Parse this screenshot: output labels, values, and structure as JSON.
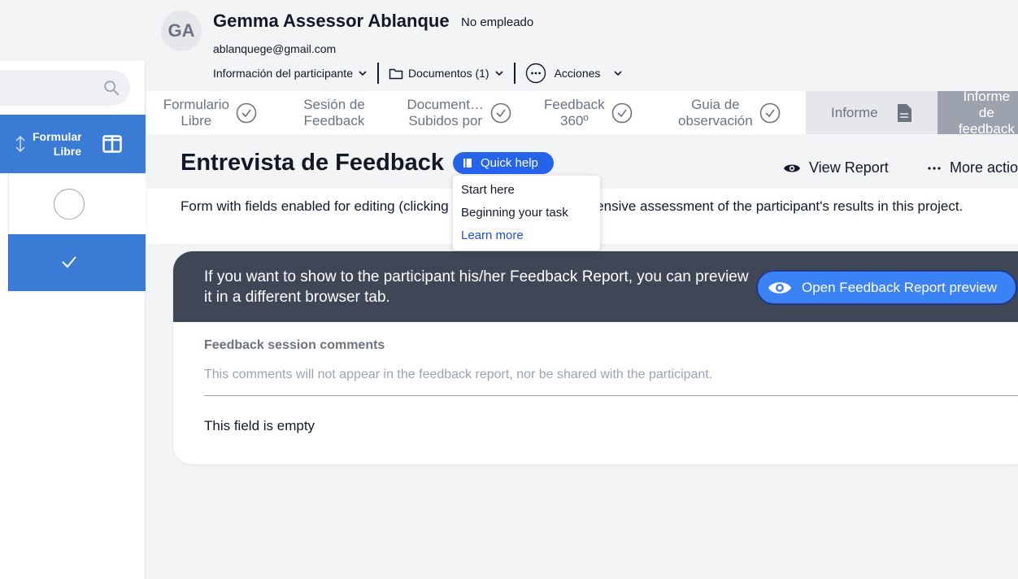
{
  "left_panel": {
    "search": {
      "icon": "search-icon"
    },
    "column_header": {
      "label": "Formulario\nLibre",
      "sort_icon": "sort-icon",
      "layout_icon": "columns-icon"
    }
  },
  "header": {
    "avatar_initials": "GA",
    "name": "Gemma Assessor Ablanque",
    "status": "No empleado",
    "email": "ablanquege@gmail.com",
    "menu": {
      "info_label": "Información del participante",
      "documents_label": "Documentos (1)",
      "actions_label": "Acciones"
    }
  },
  "tabs": [
    {
      "label": "Formulario\nLibre"
    },
    {
      "label": "Sesión de\nFeedback"
    },
    {
      "label": "Document…\nSubidos por"
    },
    {
      "label": "Feedback\n360º"
    },
    {
      "label": "Guia de\nobservación"
    },
    {
      "label": "Informe"
    },
    {
      "label": "Informe de\nfeedback"
    }
  ],
  "page": {
    "title": "Entrevista de Feedback",
    "quick_help": "Quick help",
    "view_report": "View Report",
    "more_actions": "More actions",
    "description": "Form with fields enabled for editing (clicking on them) for a comprehensive assessment of the participant's results in this project."
  },
  "quick_help_menu": {
    "items": [
      "Start here",
      "Beginning your task"
    ],
    "link": "Learn more"
  },
  "card": {
    "banner_text": "If you want to show to the participant his/her Feedback Report, you can preview it in a different browser tab.",
    "preview_button": "Open Feedback Report preview",
    "field_label": "Feedback session comments",
    "field_hint": "This comments will not appear in the feedback report, nor be shared with the participant.",
    "field_value": "This field is empty"
  },
  "colors": {
    "accent": "#3a7bd5",
    "quick_help": "#2563eb",
    "banner": "#3f4757",
    "preview_button": "#3b82f6"
  }
}
